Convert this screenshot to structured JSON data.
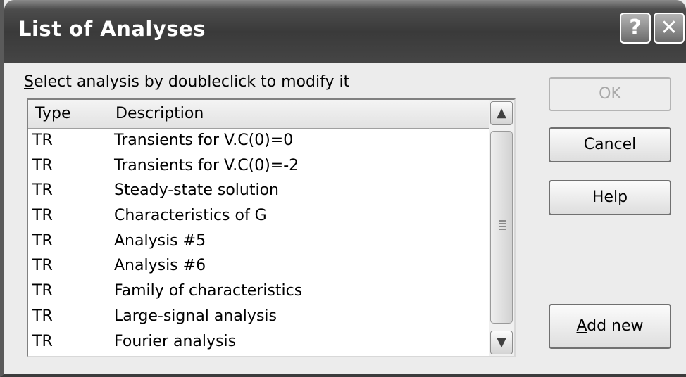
{
  "window": {
    "title": "List of Analyses",
    "help_button": "?",
    "close_button": "✕"
  },
  "prompt": {
    "underlined_letter": "S",
    "rest": "elect analysis by doubleclick to modify it"
  },
  "list": {
    "columns": [
      "Type",
      "Description"
    ],
    "rows": [
      {
        "type": "TR",
        "description": "Transients for V.C(0)=0"
      },
      {
        "type": "TR",
        "description": "Transients for V.C(0)=-2"
      },
      {
        "type": "TR",
        "description": "Steady-state solution"
      },
      {
        "type": "TR",
        "description": "Characteristics of G"
      },
      {
        "type": "TR",
        "description": "Analysis #5"
      },
      {
        "type": "TR",
        "description": "Analysis #6"
      },
      {
        "type": "TR",
        "description": "Family of characteristics"
      },
      {
        "type": "TR",
        "description": "Large-signal analysis"
      },
      {
        "type": "TR",
        "description": "Fourier analysis"
      }
    ],
    "scroll_up_icon": "chevron-up-icon",
    "scroll_down_icon": "chevron-down-icon"
  },
  "buttons": {
    "ok": "OK",
    "cancel": "Cancel",
    "help": "Help",
    "add_new_underlined": "A",
    "add_new_rest": "dd new"
  },
  "colors": {
    "titlebar": "#3a3a3a",
    "dialog_bg": "#ececec",
    "list_bg": "#ffffff",
    "disabled_text": "#a8a8a8"
  }
}
